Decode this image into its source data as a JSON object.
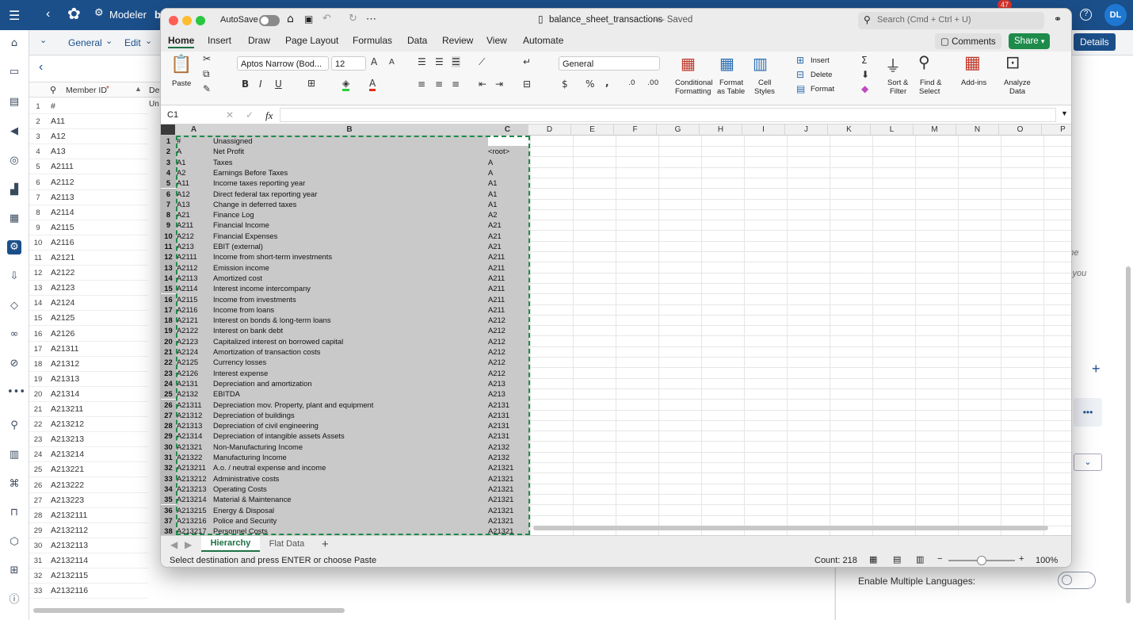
{
  "background_app": {
    "title": "Modeler",
    "title_extra": "b",
    "tabs": [
      "General",
      "Edit"
    ],
    "column_header": "Member ID",
    "column_header_extra": "De",
    "cell_extra": "Un",
    "rows": [
      {
        "n": "1",
        "v": "#"
      },
      {
        "n": "2",
        "v": "A11"
      },
      {
        "n": "3",
        "v": "A12"
      },
      {
        "n": "4",
        "v": "A13"
      },
      {
        "n": "5",
        "v": "A2111"
      },
      {
        "n": "6",
        "v": "A2112"
      },
      {
        "n": "7",
        "v": "A2113"
      },
      {
        "n": "8",
        "v": "A2114"
      },
      {
        "n": "9",
        "v": "A2115"
      },
      {
        "n": "10",
        "v": "A2116"
      },
      {
        "n": "11",
        "v": "A2121"
      },
      {
        "n": "12",
        "v": "A2122"
      },
      {
        "n": "13",
        "v": "A2123"
      },
      {
        "n": "14",
        "v": "A2124"
      },
      {
        "n": "15",
        "v": "A2125"
      },
      {
        "n": "16",
        "v": "A2126"
      },
      {
        "n": "17",
        "v": "A21311"
      },
      {
        "n": "18",
        "v": "A21312"
      },
      {
        "n": "19",
        "v": "A21313"
      },
      {
        "n": "20",
        "v": "A21314"
      },
      {
        "n": "21",
        "v": "A213211"
      },
      {
        "n": "22",
        "v": "A213212"
      },
      {
        "n": "23",
        "v": "A213213"
      },
      {
        "n": "24",
        "v": "A213214"
      },
      {
        "n": "25",
        "v": "A213221"
      },
      {
        "n": "26",
        "v": "A213222"
      },
      {
        "n": "27",
        "v": "A213223"
      },
      {
        "n": "28",
        "v": "A2132111"
      },
      {
        "n": "29",
        "v": "A2132112"
      },
      {
        "n": "30",
        "v": "A2132113"
      },
      {
        "n": "31",
        "v": "A2132114"
      },
      {
        "n": "32",
        "v": "A2132115"
      },
      {
        "n": "33",
        "v": "A2132116"
      }
    ],
    "right_text_1": "n the",
    "right_text_2": "y you",
    "enable_multiple_languages": "Enable Multiple Languages:",
    "notification_count": "47",
    "avatar": "DL",
    "details_button": "Details"
  },
  "excel": {
    "autosave": "AutoSave",
    "file_title": "balance_sheet_transactions",
    "saved": "— Saved",
    "search_placeholder": "Search (Cmd + Ctrl + U)",
    "ribbon_tabs": [
      "Home",
      "Insert",
      "Draw",
      "Page Layout",
      "Formulas",
      "Data",
      "Review",
      "View",
      "Automate"
    ],
    "comments": "Comments",
    "share": "Share",
    "font_name": "Aptos Narrow (Bod...",
    "font_size": "12",
    "number_format": "General",
    "paste": "Paste",
    "conditional_formatting_1": "Conditional",
    "conditional_formatting_2": "Formatting",
    "format_table_1": "Format",
    "format_table_2": "as Table",
    "cell_styles_1": "Cell",
    "cell_styles_2": "Styles",
    "insert": "Insert",
    "delete": "Delete",
    "format": "Format",
    "sort_filter_1": "Sort &",
    "sort_filter_2": "Filter",
    "find_select_1": "Find &",
    "find_select_2": "Select",
    "addins": "Add-ins",
    "analyze_1": "Analyze",
    "analyze_2": "Data",
    "name_box": "C1",
    "fx": "fx",
    "columns": [
      "A",
      "B",
      "C",
      "D",
      "E",
      "F",
      "G",
      "H",
      "I",
      "J",
      "K",
      "L",
      "M",
      "N",
      "O",
      "P"
    ],
    "rows": [
      [
        "1",
        "#",
        "Unassigned",
        ""
      ],
      [
        "2",
        "A",
        "Net Profit",
        "<root>"
      ],
      [
        "3",
        "A1",
        "Taxes",
        "A"
      ],
      [
        "4",
        "A2",
        "Earnings Before Taxes",
        "A"
      ],
      [
        "5",
        "A11",
        "Income taxes reporting year",
        "A1"
      ],
      [
        "6",
        "A12",
        "Direct federal tax reporting year",
        "A1"
      ],
      [
        "7",
        "A13",
        "Change in deferred taxes",
        "A1"
      ],
      [
        "8",
        "A21",
        "Finance Log",
        "A2"
      ],
      [
        "9",
        "A211",
        "Financial Income",
        "A21"
      ],
      [
        "10",
        "A212",
        "Financial Expenses",
        "A21"
      ],
      [
        "11",
        "A213",
        "EBIT (external)",
        "A21"
      ],
      [
        "12",
        "A2111",
        "Income from short-term investments",
        "A211"
      ],
      [
        "13",
        "A2112",
        "Emission income",
        "A211"
      ],
      [
        "14",
        "A2113",
        "Amortized cost",
        "A211"
      ],
      [
        "15",
        "A2114",
        "Interest income intercompany",
        "A211"
      ],
      [
        "16",
        "A2115",
        "Income from investments",
        "A211"
      ],
      [
        "17",
        "A2116",
        "Income from loans",
        "A211"
      ],
      [
        "18",
        "A2121",
        "Interest on bonds & long-term loans",
        "A212"
      ],
      [
        "19",
        "A2122",
        "Interest on bank debt",
        "A212"
      ],
      [
        "20",
        "A2123",
        "Capitalized interest on borrowed capital",
        "A212"
      ],
      [
        "21",
        "A2124",
        "Amortization of transaction costs",
        "A212"
      ],
      [
        "22",
        "A2125",
        "Currency losses",
        "A212"
      ],
      [
        "23",
        "A2126",
        "Interest expense",
        "A212"
      ],
      [
        "24",
        "A2131",
        "Depreciation and amortization",
        "A213"
      ],
      [
        "25",
        "A2132",
        "EBITDA",
        "A213"
      ],
      [
        "26",
        "A21311",
        "Depreciation mov. Property, plant and equipment",
        "A2131"
      ],
      [
        "27",
        "A21312",
        "Depreciation of buildings",
        "A2131"
      ],
      [
        "28",
        "A21313",
        "Depreciation of civil engineering",
        "A2131"
      ],
      [
        "29",
        "A21314",
        "Depreciation of intangible assets Assets",
        "A2131"
      ],
      [
        "30",
        "A21321",
        "Non-Manufacturing Income",
        "A2132"
      ],
      [
        "31",
        "A21322",
        "Manufacturing Income",
        "A2132"
      ],
      [
        "32",
        "A213211",
        "A.o. / neutral expense and income",
        "A21321"
      ],
      [
        "33",
        "A213212",
        "Administrative costs",
        "A21321"
      ],
      [
        "34",
        "A213213",
        "Operating Costs",
        "A21321"
      ],
      [
        "35",
        "A213214",
        "Material & Maintenance",
        "A21321"
      ],
      [
        "36",
        "A213215",
        "Energy & Disposal",
        "A21321"
      ],
      [
        "37",
        "A213216",
        "Police and Security",
        "A21321"
      ],
      [
        "38",
        "A213217",
        "Personnel Costs",
        "A21321"
      ]
    ],
    "sheet_tabs": [
      "Hierarchy",
      "Flat Data"
    ],
    "status_text": "Select destination and press ENTER or choose Paste",
    "count": "Count: 218",
    "zoom": "100%",
    "zoom_level": 0.5
  }
}
